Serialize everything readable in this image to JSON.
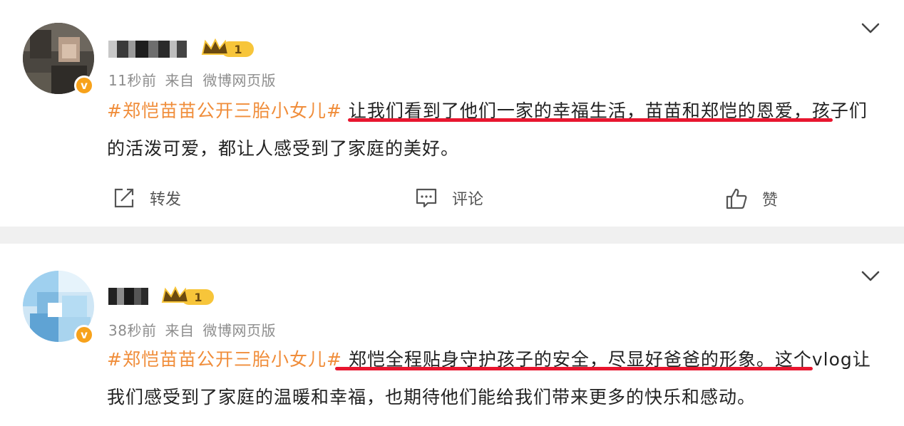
{
  "posts": [
    {
      "meta": {
        "time": "11秒前",
        "source_prefix": "来自",
        "source": "微博网页版"
      },
      "level_badge": "1",
      "verified_badge": "v",
      "body": {
        "hashtag": "#郑恺苗苗公开三胎小女儿#",
        "text": " 让我们看到了他们一家的幸福生活，苗苗和郑恺的恩爱，孩子们的活泼可爱，都让人感受到了家庭的美好。"
      },
      "actions": {
        "repost": "转发",
        "comment": "评论",
        "like": "赞"
      }
    },
    {
      "meta": {
        "time": "38秒前",
        "source_prefix": "来自",
        "source": "微博网页版"
      },
      "level_badge": "1",
      "verified_badge": "v",
      "body": {
        "hashtag": "#郑恺苗苗公开三胎小女儿#",
        "text": " 郑恺全程贴身守护孩子的安全，尽显好爸爸的形象。这个vlog让我们感受到了家庭的温暖和幸福，也期待他们能给我们带来更多的快乐和感动。"
      }
    }
  ],
  "icons": {
    "more": "chevron-down-icon",
    "repost": "repost-icon",
    "comment": "comment-icon",
    "like": "thumbs-up-icon",
    "crown": "crown-icon"
  },
  "colors": {
    "hashtag": "#f08d3a",
    "underline": "#e8162f",
    "badge": "#f7a21b",
    "separator": "#f0f0f0"
  }
}
